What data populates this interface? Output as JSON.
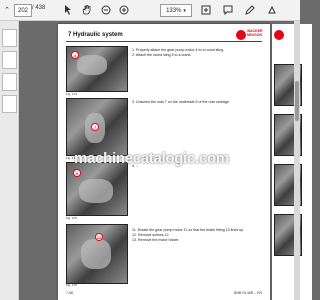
{
  "toolbar": {
    "current_page": "202",
    "total_pages": "/ 438",
    "zoom": "133%"
  },
  "page": {
    "section_title": "7   Hydraulic system",
    "logo_line1": "WACKER",
    "logo_line2": "NEUSON",
    "steps": [
      "1. Properly attach the gear pump motor 4 to a round sling.",
      "2. Attach the round sling 5 to a crane.",
      "3. Unscrew the nuts 7 on the underside 8 of the rear carriage.",
      "4. ...",
      "11. Rotate the gear pump motor 11 so that the brake fitting 10 lines up.",
      "12. Remove screws 12.",
      "13. Remove the motor holder."
    ],
    "figures": [
      "Fig. 173",
      "Fig. 174",
      "Fig. 175",
      "Fig. 176"
    ],
    "footer_left": "7-58",
    "footer_right": "BHB RL46R – EN"
  },
  "watermark": "machinecatalogic.com",
  "colors": {
    "accent": "#e30613",
    "viewer_bg": "#6b6b6b"
  }
}
